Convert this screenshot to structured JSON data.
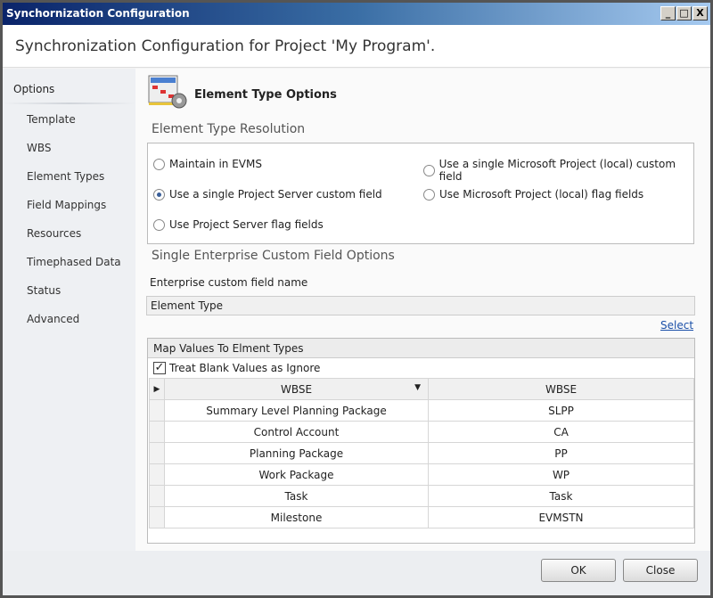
{
  "window": {
    "title": "Synchornization Configuration",
    "minimize": "_",
    "maximize": "□",
    "close": "X"
  },
  "header": "Synchronization Configuration for Project 'My Program'.",
  "sidebar": {
    "title": "Options",
    "items": [
      "Template",
      "WBS",
      "Element Types",
      "Field Mappings",
      "Resources",
      "Timephased Data",
      "Status",
      "Advanced"
    ]
  },
  "main": {
    "heading": "Element Type Options",
    "resolution_title": "Element Type Resolution",
    "radios": [
      {
        "label": "Maintain in EVMS",
        "selected": false
      },
      {
        "label": "Use a single Project Server custom field",
        "selected": true
      },
      {
        "label": "Use Project Server flag fields",
        "selected": false
      },
      {
        "label": "Use a single Microsoft Project (local) custom field",
        "selected": false
      },
      {
        "label": "Use Microsoft Project (local) flag fields",
        "selected": false
      }
    ],
    "enterprise_title": "Single Enterprise Custom Field Options",
    "field_label": "Enterprise custom field name",
    "field_value": "Element Type",
    "select_link": "Select",
    "grid": {
      "title": "Map Values To Elment Types",
      "checkbox_label": "Treat Blank Values as Ignore",
      "checkbox_checked": true,
      "columns": [
        "WBSE",
        "WBSE"
      ],
      "rows": [
        [
          "Summary Level Planning Package",
          "SLPP"
        ],
        [
          "Control Account",
          "CA"
        ],
        [
          "Planning Package",
          "PP"
        ],
        [
          "Work Package",
          "WP"
        ],
        [
          "Task",
          "Task"
        ],
        [
          "Milestone",
          "EVMSTN"
        ]
      ]
    }
  },
  "footer": {
    "ok": "OK",
    "close": "Close"
  }
}
